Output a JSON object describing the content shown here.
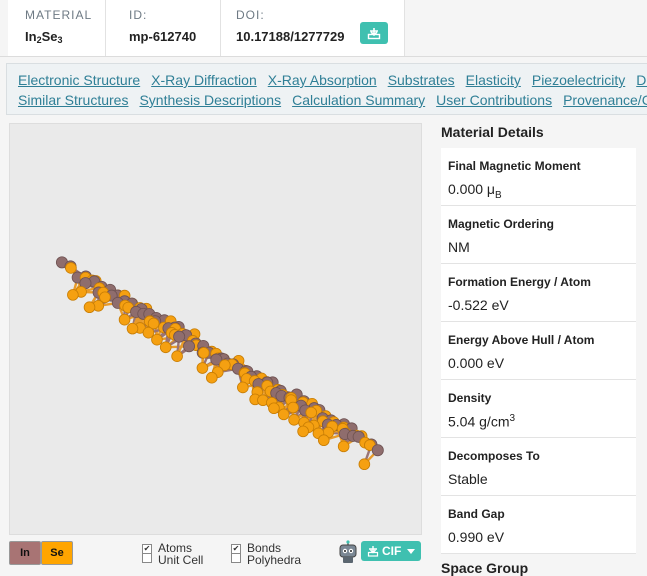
{
  "header": {
    "material_label": "MATERIAL",
    "material_base": "In",
    "material_sub1": "2",
    "material_mid": "Se",
    "material_sub2": "3",
    "id_label": "ID:",
    "id_value": "mp-612740",
    "doi_label": "DOI:",
    "doi_value": "10.17188/1277729"
  },
  "nav": {
    "row1": [
      "Electronic Structure",
      "X-Ray Diffraction",
      "X-Ray Absorption",
      "Substrates",
      "Elasticity",
      "Piezoelectricity",
      "Die"
    ],
    "row2": [
      "Similar Structures",
      "Synthesis Descriptions",
      "Calculation Summary",
      "User Contributions",
      "Provenance/C"
    ]
  },
  "viewer": {
    "elements": [
      {
        "symbol": "In",
        "color": "#a87474"
      },
      {
        "symbol": "Se",
        "color": "#ffa500"
      }
    ],
    "atom_in_color": "#8f6d6d",
    "atom_se_color": "#f5a011",
    "options": {
      "atoms": "Atoms",
      "unit_cell": "Unit Cell",
      "bonds": "Bonds",
      "polyhedra": "Polyhedra",
      "atoms_checked": true,
      "unit_cell_checked": false,
      "bonds_checked": true,
      "polyhedra_checked": false
    },
    "cif_label": "CIF"
  },
  "details": {
    "title": "Material Details",
    "items": [
      {
        "label": "Final Magnetic Moment",
        "value": "0.000 μ",
        "value_sub": "B"
      },
      {
        "label": "Magnetic Ordering",
        "value": "NM"
      },
      {
        "label": "Formation Energy / Atom",
        "value": "-0.522 eV"
      },
      {
        "label": "Energy Above Hull / Atom",
        "value": "0.000 eV"
      },
      {
        "label": "Density",
        "value": "5.04 g/cm",
        "value_sup": "3"
      },
      {
        "label": "Decomposes To",
        "value": "Stable"
      },
      {
        "label": "Band Gap",
        "value": "0.990 eV"
      }
    ],
    "space_group_title": "Space Group"
  },
  "colors": {
    "accent": "#3fc0b0",
    "link": "#2f7f96"
  }
}
